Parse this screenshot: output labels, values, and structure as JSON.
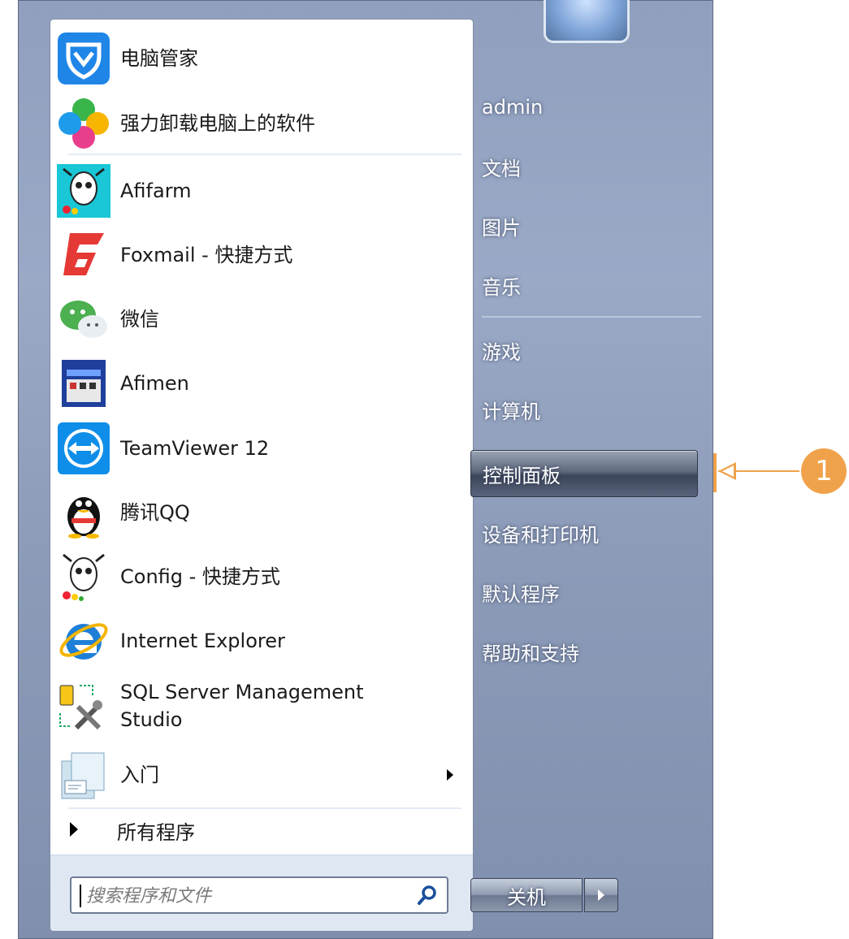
{
  "programs": [
    {
      "label": "电脑管家",
      "icon": "pc-manager-shield-icon"
    },
    {
      "label": "强力卸载电脑上的软件",
      "icon": "uninstaller-clover-icon"
    },
    {
      "label": "Afifarm",
      "icon": "afifarm-cow-icon"
    },
    {
      "label": "Foxmail - 快捷方式",
      "icon": "foxmail-icon"
    },
    {
      "label": "微信",
      "icon": "wechat-icon"
    },
    {
      "label": "Afimen",
      "icon": "afimen-icon"
    },
    {
      "label": "TeamViewer 12",
      "icon": "teamviewer-icon"
    },
    {
      "label": "腾讯QQ",
      "icon": "qq-penguin-icon"
    },
    {
      "label": "Config - 快捷方式",
      "icon": "config-cow-icon"
    },
    {
      "label": "Internet Explorer",
      "icon": "internet-explorer-icon"
    },
    {
      "label": "SQL Server Management",
      "label2": "Studio",
      "icon": "sql-server-tools-icon"
    },
    {
      "label": "入门",
      "icon": "getting-started-icon",
      "has_submenu": true
    }
  ],
  "all_programs": {
    "label": "所有程序"
  },
  "search": {
    "placeholder": "搜索程序和文件"
  },
  "right_pane": {
    "items": [
      {
        "label": "admin"
      },
      {
        "label": "文档"
      },
      {
        "label": "图片"
      },
      {
        "label": "音乐"
      },
      {
        "label": "游戏"
      },
      {
        "label": "计算机"
      },
      {
        "label": "控制面板",
        "highlighted": true
      },
      {
        "label": "设备和打印机"
      },
      {
        "label": "默认程序"
      },
      {
        "label": "帮助和支持"
      }
    ],
    "shutdown_label": "关机"
  },
  "callout": {
    "number": "1",
    "color": "#f0a24b"
  }
}
